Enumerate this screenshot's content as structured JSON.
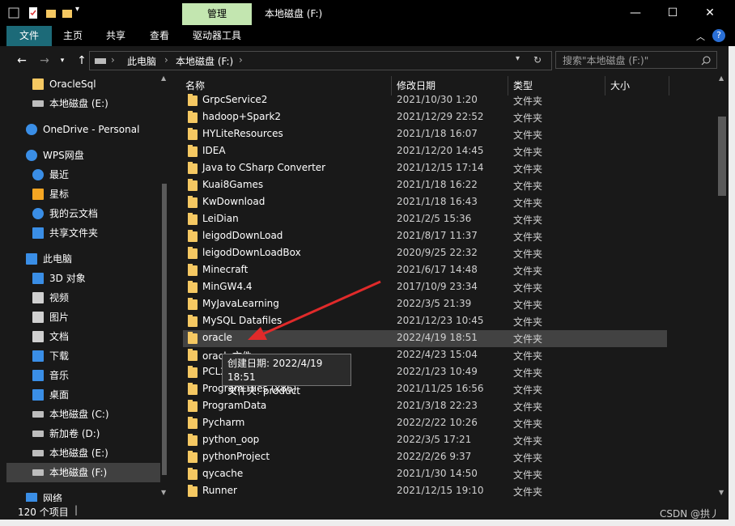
{
  "window": {
    "contextual_tab_group": "管理",
    "title": "本地磁盘 (F:)",
    "minimize": "—",
    "maximize": "☐",
    "close": "✕"
  },
  "ribbon": {
    "tabs": [
      "文件",
      "主页",
      "共享",
      "查看",
      "驱动器工具"
    ]
  },
  "address": {
    "path": [
      "此电脑",
      "本地磁盘 (F:)"
    ],
    "search_placeholder": "搜索\"本地磁盘 (F:)\""
  },
  "nav": {
    "items": [
      {
        "label": "OracleSql",
        "icon": "folder-icon"
      },
      {
        "label": "本地磁盘 (E:)",
        "icon": "drive-icon"
      },
      {
        "label": "OneDrive - Personal",
        "icon": "cloud-icon"
      },
      {
        "label": "WPS网盘",
        "icon": "wps-cloud-icon"
      },
      {
        "label": "最近",
        "icon": "clock-icon"
      },
      {
        "label": "星标",
        "icon": "star-icon"
      },
      {
        "label": "我的云文档",
        "icon": "cloud-docs-icon"
      },
      {
        "label": "共享文件夹",
        "icon": "share-icon"
      },
      {
        "label": "此电脑",
        "icon": "computer-icon"
      },
      {
        "label": "3D 对象",
        "icon": "cube-icon"
      },
      {
        "label": "视频",
        "icon": "video-icon"
      },
      {
        "label": "图片",
        "icon": "picture-icon"
      },
      {
        "label": "文档",
        "icon": "document-icon"
      },
      {
        "label": "下载",
        "icon": "download-icon"
      },
      {
        "label": "音乐",
        "icon": "music-icon"
      },
      {
        "label": "桌面",
        "icon": "desktop-icon"
      },
      {
        "label": "本地磁盘 (C:)",
        "icon": "drive-icon"
      },
      {
        "label": "新加卷 (D:)",
        "icon": "drive-icon"
      },
      {
        "label": "本地磁盘 (E:)",
        "icon": "drive-icon"
      },
      {
        "label": "本地磁盘 (F:)",
        "icon": "drive-icon",
        "selected": true
      },
      {
        "label": "网络",
        "icon": "network-icon"
      }
    ]
  },
  "columns": {
    "name": "名称",
    "date": "修改日期",
    "type": "类型",
    "size": "大小"
  },
  "files": [
    {
      "name": "GrpcService2",
      "date": "2021/10/30 1:20",
      "type": "文件夹"
    },
    {
      "name": "hadoop+Spark2",
      "date": "2021/12/29 22:52",
      "type": "文件夹"
    },
    {
      "name": "HYLiteResources",
      "date": "2021/1/18 16:07",
      "type": "文件夹"
    },
    {
      "name": "IDEA",
      "date": "2021/12/20 14:45",
      "type": "文件夹"
    },
    {
      "name": "Java to CSharp Converter",
      "date": "2021/12/15 17:14",
      "type": "文件夹"
    },
    {
      "name": "Kuai8Games",
      "date": "2021/1/18 16:22",
      "type": "文件夹"
    },
    {
      "name": "KwDownload",
      "date": "2021/1/18 16:43",
      "type": "文件夹"
    },
    {
      "name": "LeiDian",
      "date": "2021/2/5 15:36",
      "type": "文件夹"
    },
    {
      "name": "leigodDownLoad",
      "date": "2021/8/17 11:37",
      "type": "文件夹"
    },
    {
      "name": "leigodDownLoadBox",
      "date": "2020/9/25 22:32",
      "type": "文件夹"
    },
    {
      "name": "Minecraft",
      "date": "2021/6/17 14:48",
      "type": "文件夹"
    },
    {
      "name": "MinGW4.4",
      "date": "2017/10/9 23:34",
      "type": "文件夹"
    },
    {
      "name": "MyJavaLearning",
      "date": "2022/3/5 21:39",
      "type": "文件夹"
    },
    {
      "name": "MySQL Datafiles",
      "date": "2021/12/23 10:45",
      "type": "文件夹"
    },
    {
      "name": "oracle",
      "date": "2022/4/19 18:51",
      "type": "文件夹",
      "selected": true
    },
    {
      "name": "oracle文件",
      "date": "2022/4/23 15:04",
      "type": "文件夹"
    },
    {
      "name": "PCL2",
      "date": "2022/1/23 10:49",
      "type": "文件夹"
    },
    {
      "name": "Program Files (x86)",
      "date": "2021/11/25 16:56",
      "type": "文件夹"
    },
    {
      "name": "ProgramData",
      "date": "2021/3/18 22:23",
      "type": "文件夹"
    },
    {
      "name": "Pycharm",
      "date": "2022/2/22 10:26",
      "type": "文件夹"
    },
    {
      "name": "python_oop",
      "date": "2022/3/5 17:21",
      "type": "文件夹"
    },
    {
      "name": "pythonProject",
      "date": "2022/2/26 9:37",
      "type": "文件夹"
    },
    {
      "name": "qycache",
      "date": "2021/1/30 14:50",
      "type": "文件夹"
    },
    {
      "name": "Runner",
      "date": "2021/12/15 19:10",
      "type": "文件夹"
    }
  ],
  "tooltip": {
    "line1": "创建日期: 2022/4/19 18:51",
    "line2": "文件夹: product"
  },
  "status": {
    "item_count": "120 个项目"
  },
  "watermark": "CSDN @拱丿",
  "colors": {
    "background": "#191919",
    "accent_tab": "#1c6a78",
    "manage_tab": "#c3e6b0",
    "selection": "#424242",
    "annotation_arrow": "#e02a2a",
    "folder": "#f5c862"
  }
}
